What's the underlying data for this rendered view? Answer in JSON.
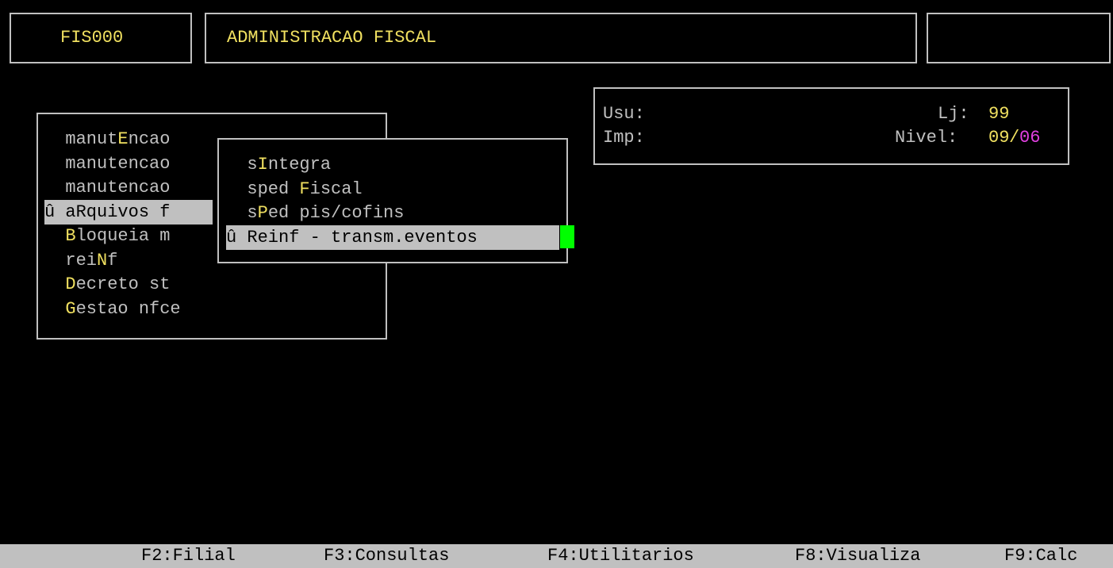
{
  "header": {
    "program_code": "FIS000",
    "title": "ADMINISTRACAO FISCAL",
    "right_box": ""
  },
  "info_panel": {
    "usu_label": "Usu:",
    "imp_label": "Imp:",
    "lj_label": "Lj:",
    "lj_value": "99",
    "nivel_label": "Nivel:",
    "nivel_value_1": "09",
    "nivel_sep": "/",
    "nivel_value_2": "06"
  },
  "main_menu": {
    "items": [
      {
        "pre": "  manut",
        "hot": "E",
        "post": "ncao"
      },
      {
        "pre": "  manutencao",
        "hot": "",
        "post": ""
      },
      {
        "pre": "  manutencao",
        "hot": "",
        "post": ""
      },
      {
        "pre": "û aRquivos f",
        "hot": "",
        "post": ""
      },
      {
        "pre": "  ",
        "hot": "B",
        "post": "loqueia m"
      },
      {
        "pre": "  rei",
        "hot": "N",
        "post": "f"
      },
      {
        "pre": "  ",
        "hot": "D",
        "post": "ecreto st"
      },
      {
        "pre": "  ",
        "hot": "G",
        "post": "estao nfce"
      }
    ],
    "selected_index": 3
  },
  "sub_menu": {
    "items": [
      {
        "pre": "  s",
        "hot": "I",
        "post": "ntegra"
      },
      {
        "pre": "  sped ",
        "hot": "F",
        "post": "iscal"
      },
      {
        "pre": "  s",
        "hot": "P",
        "post": "ed pis/cofins"
      },
      {
        "pre": "û Reinf - transm.eventos",
        "hot": "",
        "post": ""
      }
    ],
    "selected_index": 3
  },
  "function_keys": [
    "F2:Filial",
    "F3:Consultas",
    "F4:Utilitarios",
    "F8:Visualiza",
    "F9:Calc"
  ],
  "colors": {
    "background": "#000000",
    "text": "#c0c0c0",
    "hotkey": "#f0e060",
    "magenta": "#e040e0",
    "cursor": "#00ff00",
    "status_bar": "#c0c0c0"
  }
}
